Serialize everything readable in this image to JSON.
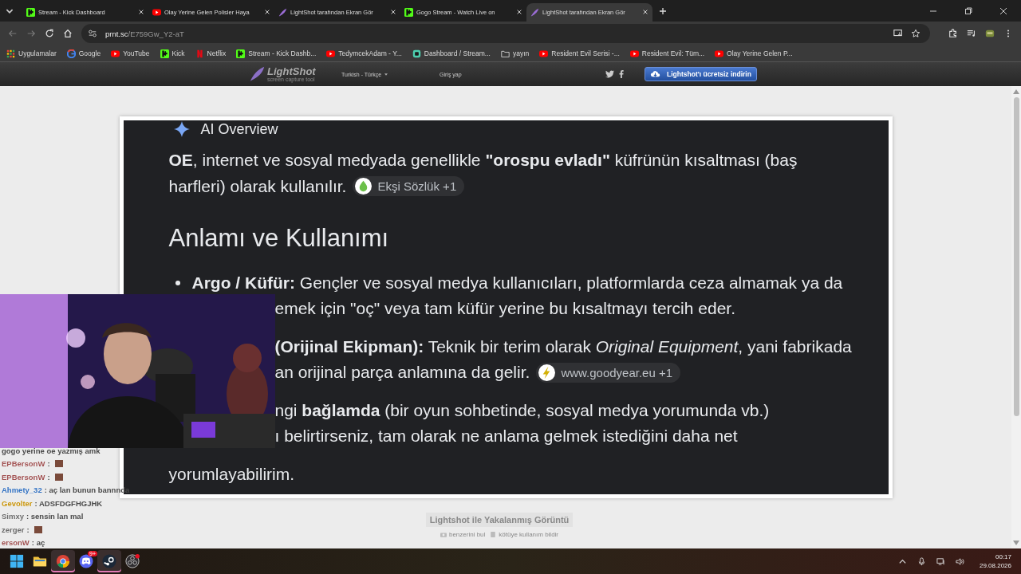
{
  "browser": {
    "tabs": [
      {
        "title": "Stream - Kick Dashboard",
        "kind": "kick",
        "selected": false
      },
      {
        "title": "Olay Yerine Gelen Polisler Haya",
        "kind": "youtube",
        "selected": false
      },
      {
        "title": "LightShot tarafından Ekran Gör",
        "kind": "lightshot",
        "selected": false
      },
      {
        "title": "Gogo Stream - Watch Live on",
        "kind": "kick",
        "selected": false
      },
      {
        "title": "LightShot tarafından Ekran Gör",
        "kind": "lightshot",
        "selected": true
      }
    ],
    "address": {
      "host": "prnt.sc",
      "path": "/E759Gw_Y2-aT"
    },
    "bookmarks": [
      {
        "label": "Uygulamalar",
        "kind": "apps"
      },
      {
        "label": "Google",
        "kind": "google"
      },
      {
        "label": "YouTube",
        "kind": "youtube"
      },
      {
        "label": "Kick",
        "kind": "kick"
      },
      {
        "label": "Netflix",
        "kind": "netflix"
      },
      {
        "label": "Stream - Kick Dashb...",
        "kind": "kick"
      },
      {
        "label": "TedymcekAdam - Y...",
        "kind": "youtube"
      },
      {
        "label": "Dashboard / Stream...",
        "kind": "dashboard"
      },
      {
        "label": "yayın",
        "kind": "folder"
      },
      {
        "label": "Resident Evil Serisi -...",
        "kind": "youtube"
      },
      {
        "label": "Resident Evil: Tüm...",
        "kind": "youtube"
      },
      {
        "label": "Olay Yerine Gelen P...",
        "kind": "youtube"
      }
    ]
  },
  "lightshot_header": {
    "logo": "LightShot",
    "tagline": "screen capture tool",
    "language": "Turkish - Türkçe",
    "login": "Giriş yap",
    "download_button": "Lightshot'ı ücretsiz indirin"
  },
  "screenshot": {
    "heading": "AI Overview",
    "intro": [
      {
        "text": "**OE**, internet ve sosyal medyada genellikle **\"orospu evladı\"** küfrünün kısaltması (baş"
      },
      {
        "text": "harfleri) olarak kullanılır.",
        "source": {
          "label": "Ekşi Sözlük +1",
          "kind": "drop"
        }
      }
    ],
    "section_title": "Anlamı ve Kullanımı",
    "lines": [
      {
        "text": "**Argo / Küfür:** Gençler ve sosyal medya kullanıcıları, platformlarda ceza almamak ya da",
        "bullet": true,
        "covered": false
      },
      {
        "text": "emek için \"oç\" veya tam küfür yerine bu kısaltmayı tercih eder.",
        "bullet": false,
        "covered": true
      },
      {
        "text": "**(Orijinal Ekipman):** Teknik bir terim olarak *Original Equipment*, yani fabrikada",
        "bullet": false,
        "covered": true
      },
      {
        "text": "an orijinal parça anlamına da gelir.",
        "bullet": false,
        "covered": true,
        "source": {
          "label": "www.goodyear.eu +1",
          "kind": "bolt"
        }
      },
      {
        "text": "ngi **bağlamda** (bir oyun sohbetinde, sosyal medya yorumunda vb.)",
        "bullet": false,
        "covered": true
      },
      {
        "text": "ı belirtirseniz, tam olarak ne anlama gelmek istediğini daha net",
        "bullet": false,
        "covered": true
      },
      {
        "text": "yorumlayabilirim.",
        "bullet": false,
        "covered": false
      }
    ]
  },
  "stream_chat": [
    {
      "message": "gogo yerine oe yazmış amk",
      "emote": false
    },
    {
      "user": "EPBersonW",
      "color": "#a05050",
      "message": ":",
      "emote": true
    },
    {
      "user": "EPBersonW",
      "color": "#a05050",
      "message": ":",
      "emote": true
    },
    {
      "user": "Ahmety_32",
      "color": "#2f6fc0",
      "message": ": aç lan bunun bannnda",
      "emote": false
    },
    {
      "user": "Gevolter",
      "color": "#c8940a",
      "message": ": ADSFDGFHGJHK",
      "emote": false
    },
    {
      "user": "Simxy",
      "color": "#6a6a6a",
      "message": ": sensin lan mal",
      "emote": false
    },
    {
      "user": "zerger",
      "color": "#6a6a6a",
      "message": ":",
      "emote": true
    },
    {
      "user": "ersonW",
      "color": "#a05050",
      "message": ": aç",
      "emote": false
    }
  ],
  "footer": {
    "title": "Lightshot ile Yakalanmış Görüntü",
    "links": [
      "benzerini bul",
      "kötüye kullanım bildir"
    ]
  },
  "taskbar": {
    "apps": [
      {
        "kind": "start",
        "selected": false
      },
      {
        "kind": "explorer",
        "selected": false
      },
      {
        "kind": "chrome",
        "selected": true
      },
      {
        "kind": "discord",
        "selected": false,
        "badge": "9+"
      },
      {
        "kind": "steam",
        "selected": true
      },
      {
        "kind": "obs",
        "selected": false
      }
    ],
    "time": "00:17",
    "date": "29.08.2026"
  }
}
